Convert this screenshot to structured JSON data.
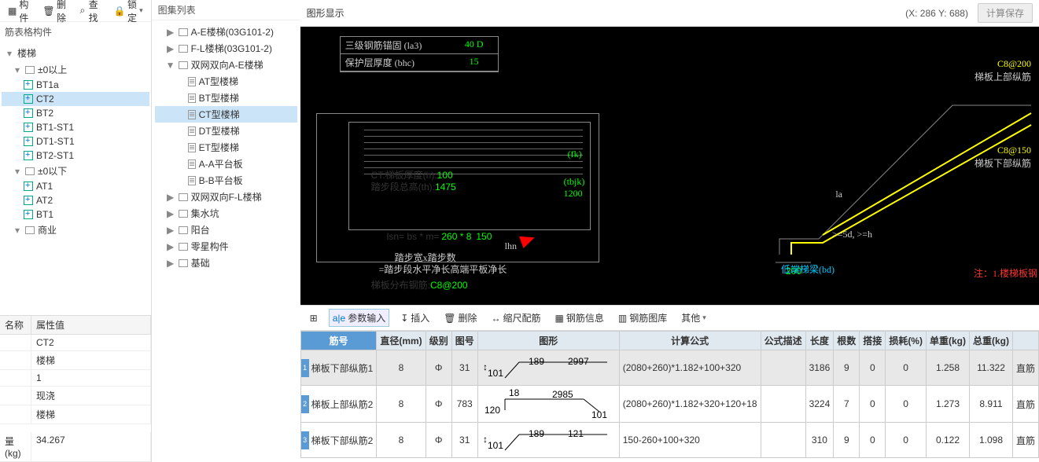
{
  "toolbar_left": {
    "component": "构件",
    "delete": "删除",
    "find": "查找",
    "lock": "锁定"
  },
  "left": {
    "header": "筋表格构件",
    "items": [
      {
        "label": "楼梯",
        "type": "root"
      },
      {
        "label": "±0以上",
        "type": "group"
      },
      {
        "label": "BT1a",
        "type": "leaf"
      },
      {
        "label": "CT2",
        "type": "leaf",
        "selected": true
      },
      {
        "label": "BT2",
        "type": "leaf"
      },
      {
        "label": "BT1-ST1",
        "type": "leaf"
      },
      {
        "label": "DT1-ST1",
        "type": "leaf"
      },
      {
        "label": "BT2-ST1",
        "type": "leaf"
      },
      {
        "label": "±0以下",
        "type": "group"
      },
      {
        "label": "AT1",
        "type": "leaf"
      },
      {
        "label": "AT2",
        "type": "leaf"
      },
      {
        "label": "BT1",
        "type": "leaf"
      },
      {
        "label": "商业",
        "type": "group"
      }
    ],
    "prop_headers": {
      "name": "名称",
      "value": "属性值"
    },
    "props": [
      {
        "n": "",
        "v": "CT2"
      },
      {
        "n": "",
        "v": "楼梯"
      },
      {
        "n": "",
        "v": "1"
      },
      {
        "n": "",
        "v": "现浇"
      },
      {
        "n": "",
        "v": "楼梯"
      }
    ],
    "weight_label": "量(kg)",
    "weight_value": "34.267"
  },
  "mid": {
    "title": "图集列表",
    "items": [
      {
        "label": "A-E楼梯(03G101-2)",
        "exp": "▶",
        "type": "folder"
      },
      {
        "label": "F-L楼梯(03G101-2)",
        "exp": "▶",
        "type": "folder"
      },
      {
        "label": "双网双向A-E楼梯",
        "exp": "▼",
        "type": "folder"
      },
      {
        "label": "AT型楼梯",
        "type": "doc",
        "ind": 3
      },
      {
        "label": "BT型楼梯",
        "type": "doc",
        "ind": 3
      },
      {
        "label": "CT型楼梯",
        "type": "doc",
        "ind": 3,
        "selected": true
      },
      {
        "label": "DT型楼梯",
        "type": "doc",
        "ind": 3
      },
      {
        "label": "ET型楼梯",
        "type": "doc",
        "ind": 3
      },
      {
        "label": "A-A平台板",
        "type": "doc",
        "ind": 3
      },
      {
        "label": "B-B平台板",
        "type": "doc",
        "ind": 3
      },
      {
        "label": "双网双向F-L楼梯",
        "exp": "▶",
        "type": "folder"
      },
      {
        "label": "集水坑",
        "exp": "▶",
        "type": "folder"
      },
      {
        "label": "阳台",
        "exp": "▶",
        "type": "folder"
      },
      {
        "label": "零星构件",
        "exp": "▶",
        "type": "folder"
      },
      {
        "label": "基础",
        "exp": "▶",
        "type": "folder"
      }
    ]
  },
  "drawing": {
    "title": "图形显示",
    "coords": "(X: 286 Y: 688)",
    "calc_save": "计算保存",
    "table": [
      {
        "l": "三级钢筋锚固 (la3)",
        "v": "40 D"
      },
      {
        "l": "保护层厚度 (bhc)",
        "v": "15"
      }
    ],
    "info_line1": "CT.梯板厚度(h):",
    "info_val1": "100",
    "info_line2": "踏步段总高(th):",
    "info_val2": "1475",
    "lsn": "lsn= bs * m=",
    "lsn_calc": "260 * 8",
    "lsn_val": "150",
    "lhn": "lhn",
    "note1": "踏步宽x踏步数",
    "note2": "=踏步段水平净长高端平板净长",
    "note3": "梯板分布钢筋:",
    "note3v": "C8@200",
    "fk": "(fk)",
    "tbjk": "(tbjk)",
    "tbjk_v": "1200",
    "la": "la",
    "cond": ">=5d, >=h",
    "b200": "200",
    "low_beam": "低端梯梁(bd)",
    "top_bar": "C8@200",
    "top_lbl": "梯板上部纵筋",
    "bot_bar": "C8@150",
    "bot_lbl": "梯板下部纵筋",
    "note_right": "注：1.楼梯板钢"
  },
  "btoolbar": {
    "param": "参数输入",
    "insert": "插入",
    "delete": "删除",
    "scale": "缩尺配筋",
    "rebar_info": "钢筋信息",
    "rebar_lib": "钢筋图库",
    "other": "其他"
  },
  "grid": {
    "headers": [
      "筋号",
      "直径(mm)",
      "级别",
      "图号",
      "图形",
      "计算公式",
      "公式描述",
      "长度",
      "根数",
      "搭接",
      "损耗(%)",
      "单重(kg)",
      "总重(kg)",
      ""
    ],
    "rows": [
      {
        "no": 1,
        "name": "梯板下部纵筋1",
        "dia": 8,
        "grade": "Φ",
        "fig": 31,
        "shape": {
          "a": "101",
          "b": "189",
          "c": "2997"
        },
        "formula": "(2080+260)*1.182+100+320",
        "desc": "",
        "len": 3186,
        "cnt": 9,
        "lap": 0,
        "loss": 0,
        "uw": "1.258",
        "tw": "11.322",
        "t": "直筋"
      },
      {
        "no": 2,
        "name": "梯板上部纵筋2",
        "dia": 8,
        "grade": "Φ",
        "fig": 783,
        "shape2": {
          "a": "18",
          "b": "2985",
          "c": "120",
          "d": "101"
        },
        "formula": "(2080+260)*1.182+320+120+18",
        "desc": "",
        "len": 3224,
        "cnt": 7,
        "lap": 0,
        "loss": 0,
        "uw": "1.273",
        "tw": "8.911",
        "t": "直筋"
      },
      {
        "no": 3,
        "name": "梯板下部纵筋2",
        "dia": 8,
        "grade": "Φ",
        "fig": 31,
        "shape": {
          "a": "101",
          "b": "189",
          "c": "121"
        },
        "formula": "150-260+100+320",
        "desc": "",
        "len": 310,
        "cnt": 9,
        "lap": 0,
        "loss": 0,
        "uw": "0.122",
        "tw": "1.098",
        "t": "直筋"
      }
    ]
  }
}
